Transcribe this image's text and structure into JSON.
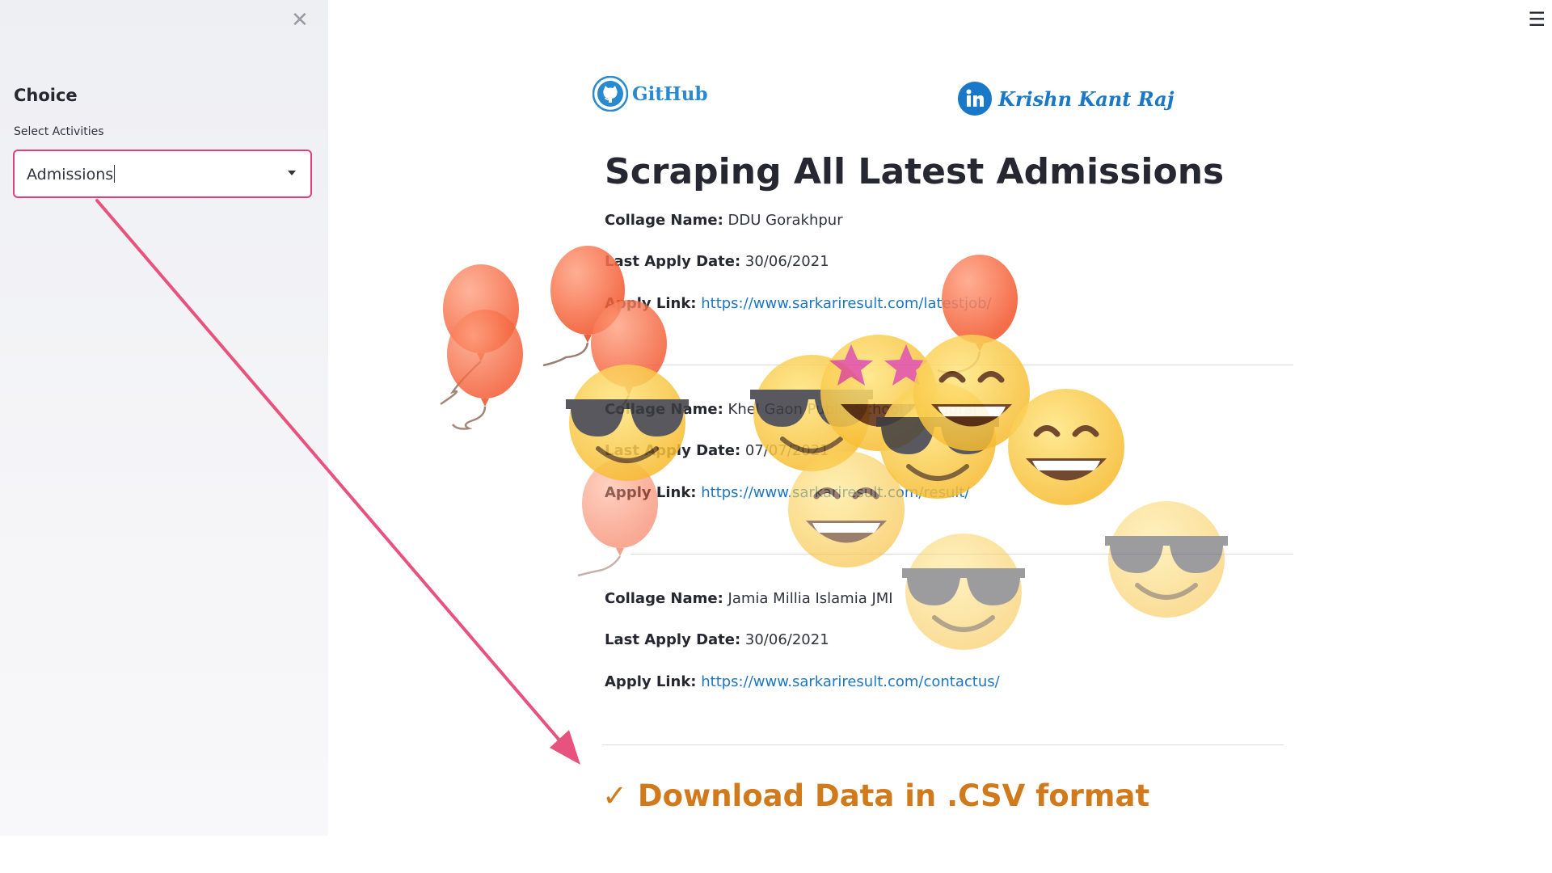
{
  "sidebar": {
    "close_icon": "close-icon",
    "title": "Choice",
    "select": {
      "label": "Select Activities",
      "value": "Admissions",
      "icon": "chevron-down-icon"
    }
  },
  "header": {
    "menu_icon": "hamburger-icon",
    "github_label": "GitHub",
    "linkedin_label": "Krishn Kant Raj"
  },
  "main": {
    "title": "Scraping All Latest Admissions",
    "labels": {
      "college": "Collage Name:",
      "date": "Last Apply Date:",
      "link": "Apply Link:"
    },
    "records": [
      {
        "college": "DDU Gorakhpur",
        "date": "30/06/2021",
        "link": "https://www.sarkariresult.com/latestjob/"
      },
      {
        "college": "Khel Gaon Public School Prayagraj",
        "date": "07/07/2021",
        "link": "https://www.sarkariresult.com/result/"
      },
      {
        "college": "Jamia Millia Islamia JMI",
        "date": "30/06/2021",
        "link": "https://www.sarkariresult.com/contactus/"
      }
    ],
    "download_label": "✓ Download Data in .CSV format"
  },
  "colors": {
    "accent_border": "#e0407a",
    "link": "#1c76c5",
    "download": "#d17a1c",
    "arrow": "#e8527e"
  }
}
